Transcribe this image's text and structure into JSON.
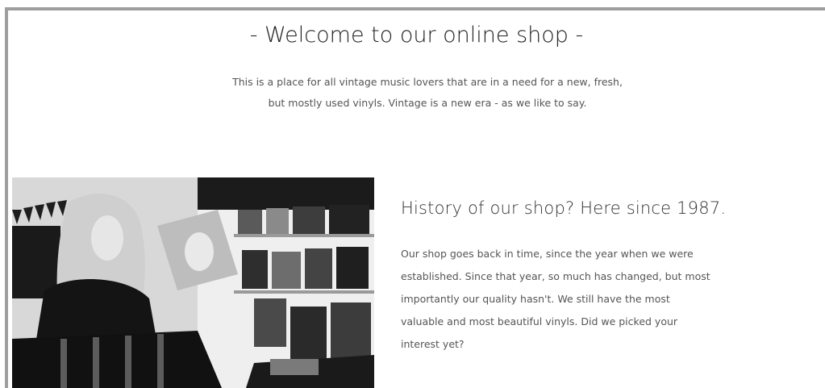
{
  "welcome": {
    "title": "- Welcome to our online shop -",
    "line1": "This is a place for all vintage music lovers that are in a need for a new, fresh,",
    "line2": "but mostly used vinyls. Vintage is a new era - as we like to say."
  },
  "history": {
    "title": "History of our shop? Here since 1987.",
    "line1": "Our shop goes back in time, since the year when we were",
    "line2": "established. Since that year, so much has changed, but most",
    "line3": "importantly our quality hasn't. We still have the most",
    "line4": "valuable and most beautiful vinyls. Did we picked your",
    "line5": "interest yet?"
  },
  "colors": {
    "frame": "#9e9e9e",
    "heading": "#222222",
    "body_text": "#555555"
  }
}
